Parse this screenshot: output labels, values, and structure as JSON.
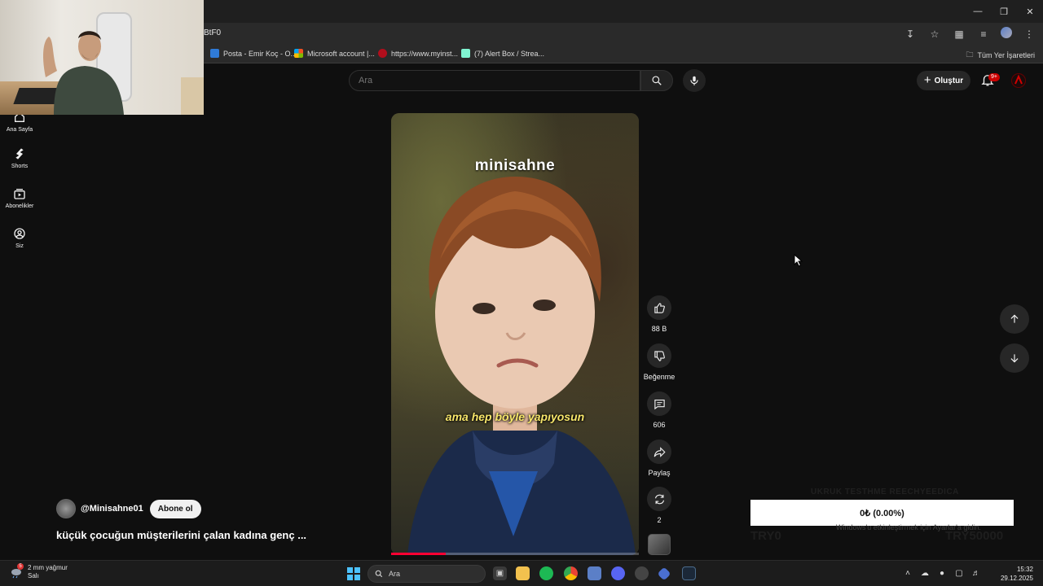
{
  "browser": {
    "url_fragment": "BtF0",
    "bookmarks": [
      {
        "label": "Posta - Emir Koç - O...",
        "icon": "outlook-icon",
        "color": "#2f7bd8"
      },
      {
        "label": "Microsoft account |...",
        "icon": "microsoft-icon",
        "color": "#f25022"
      },
      {
        "label": "https://www.myinst...",
        "icon": "myinstants-icon",
        "color": "#b10e1c"
      },
      {
        "label": "(7) Alert Box / Strea...",
        "icon": "streamlabs-icon",
        "color": "#80f5d2"
      }
    ],
    "all_bookmarks_label": "Tüm Yer İşaretleri"
  },
  "youtube": {
    "search_placeholder": "Ara",
    "create_label": "Oluştur",
    "notification_badge": "9+",
    "sidebar": [
      {
        "label": "Ana Sayfa",
        "icon": "home-icon"
      },
      {
        "label": "Shorts",
        "icon": "shorts-icon"
      },
      {
        "label": "Abonelikler",
        "icon": "subscriptions-icon"
      },
      {
        "label": "Siz",
        "icon": "account-icon"
      }
    ],
    "short": {
      "overlay_title": "minisahne",
      "subtitle": "ama hep böyle yapıyosun",
      "progress_fraction": 0.22,
      "channel": "@Minisahne01",
      "subscribe_label": "Abone ol",
      "title": "küçük çocuğun müşterilerini çalan kadına genç ..."
    },
    "actions": {
      "likes": "88 B",
      "dislike_label": "Beğenme",
      "comments": "606",
      "share_label": "Paylaş",
      "remix_count": "2"
    }
  },
  "overlay": {
    "donation_title": "UKRUK TESTHME REECHYEEDICA",
    "donation_progress": "0₺ (0.00%)",
    "donation_left": "TRY0",
    "donation_right": "TRY50000",
    "activation_text": "Windows'u etkinleştirmek için Ayarlar'a gidin."
  },
  "taskbar": {
    "weather_temp": "2 mm yağmur",
    "weather_day": "Salı",
    "weather_badge": "5",
    "search_placeholder": "Ara",
    "time": "15:32",
    "date": "29.12.2025"
  }
}
